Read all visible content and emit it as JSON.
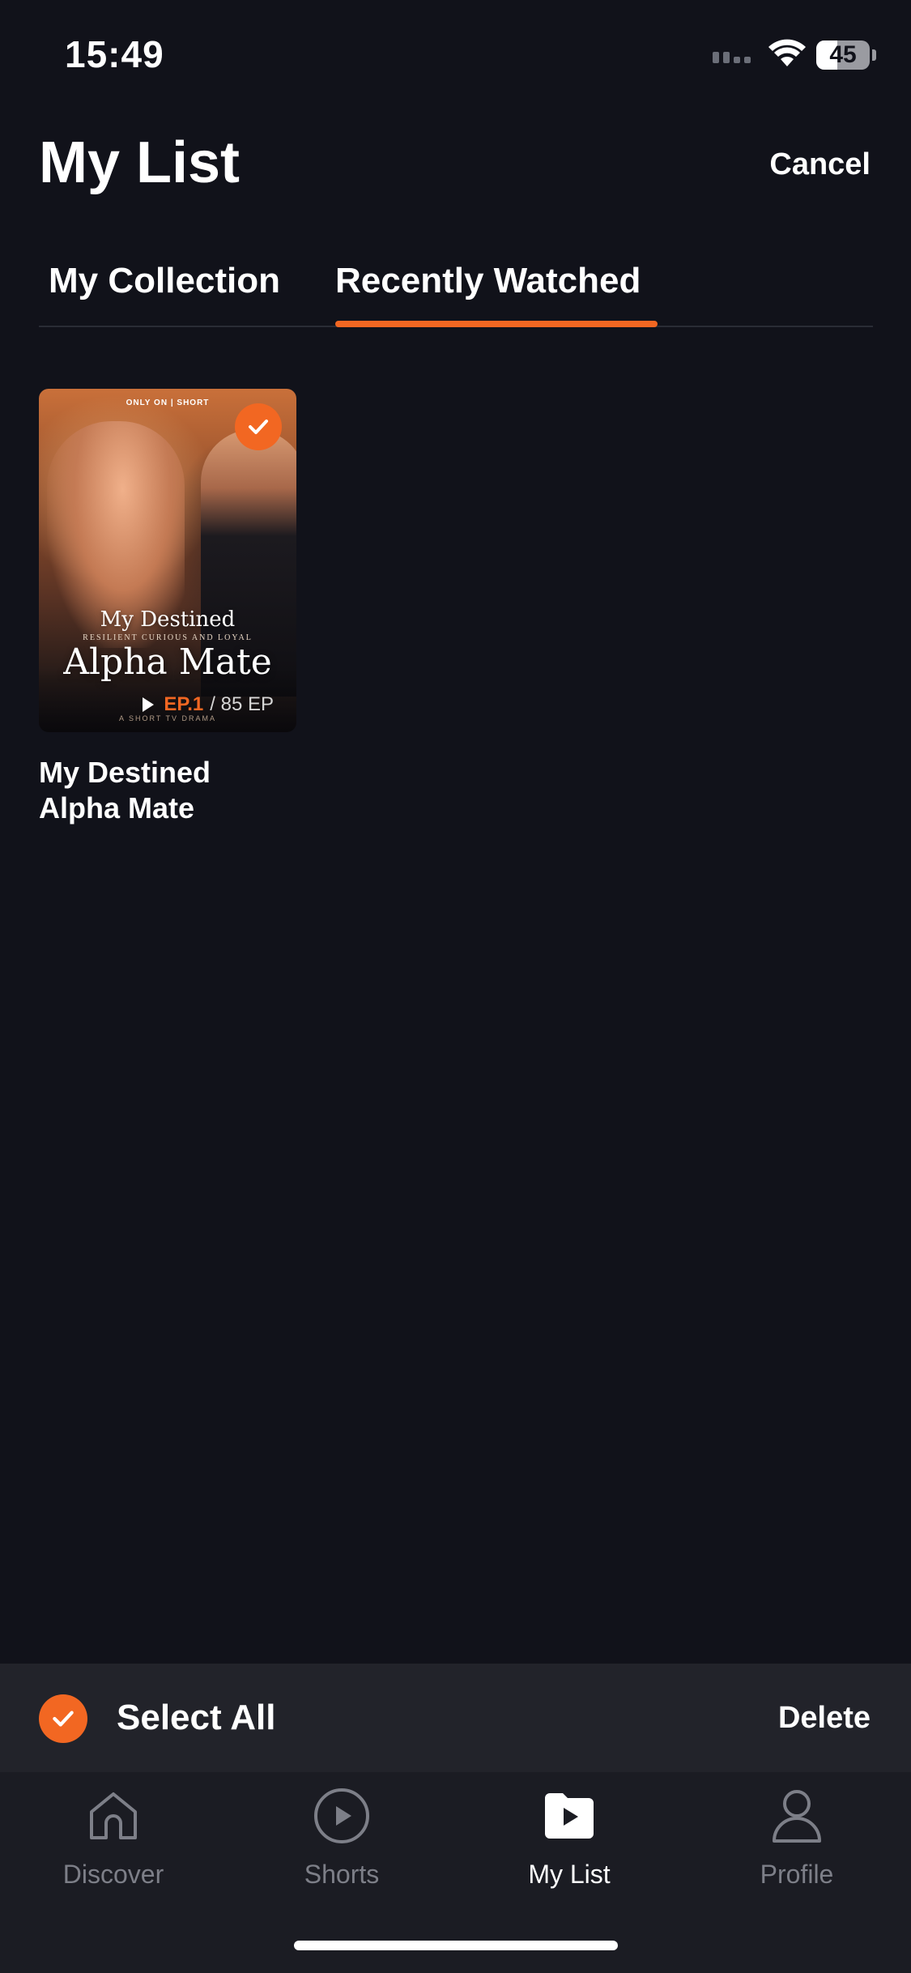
{
  "status_bar": {
    "time": "15:49",
    "battery": "45"
  },
  "header": {
    "title": "My List",
    "cancel_label": "Cancel"
  },
  "tabs": [
    {
      "label": "My Collection",
      "active": false
    },
    {
      "label": "Recently Watched",
      "active": true
    }
  ],
  "items": [
    {
      "title": "My Destined Alpha Mate",
      "poster": {
        "top_text": "ONLY ON | SHORT",
        "title_line1": "My Destined",
        "tagline": "RESILIENT CURIOUS AND LOYAL",
        "title_line2": "Alpha Mate",
        "tag": "A SHORT TV DRAMA"
      },
      "episode_current": "EP.1",
      "episode_total": "/ 85 EP",
      "selected": true
    }
  ],
  "action_bar": {
    "select_all_label": "Select All",
    "delete_label": "Delete"
  },
  "nav": [
    {
      "label": "Discover",
      "icon": "home-icon"
    },
    {
      "label": "Shorts",
      "icon": "play-circle-icon"
    },
    {
      "label": "My List",
      "icon": "folder-play-icon",
      "active": true
    },
    {
      "label": "Profile",
      "icon": "person-icon"
    }
  ],
  "colors": {
    "accent": "#f26722",
    "background": "#11121a",
    "action_bar": "#22232a",
    "tab_bar": "#1b1c23"
  }
}
